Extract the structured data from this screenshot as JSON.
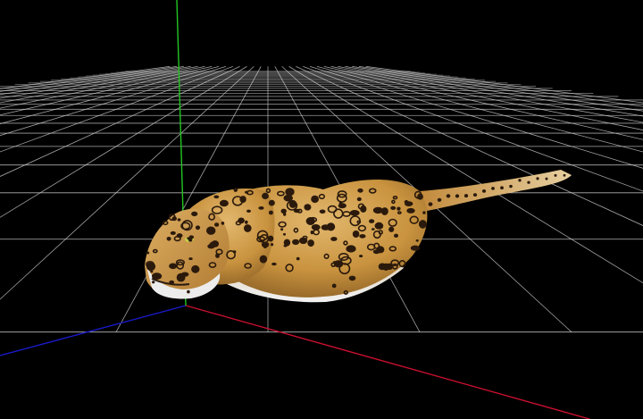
{
  "viewport": {
    "background_color": "#000000",
    "grid_color": "#d8d8d8",
    "axis_x_color": "#c8102e",
    "axis_y_color": "#22c522",
    "axis_z_color": "#1a1acc"
  },
  "model": {
    "subject": "jaguar",
    "pose": "crouching",
    "fur_base_color": "#c9933f",
    "fur_light_color": "#e0b46a",
    "belly_color": "#eeeeee",
    "spot_color": "#2b1a0c",
    "eye_color": "#c8d24a"
  }
}
